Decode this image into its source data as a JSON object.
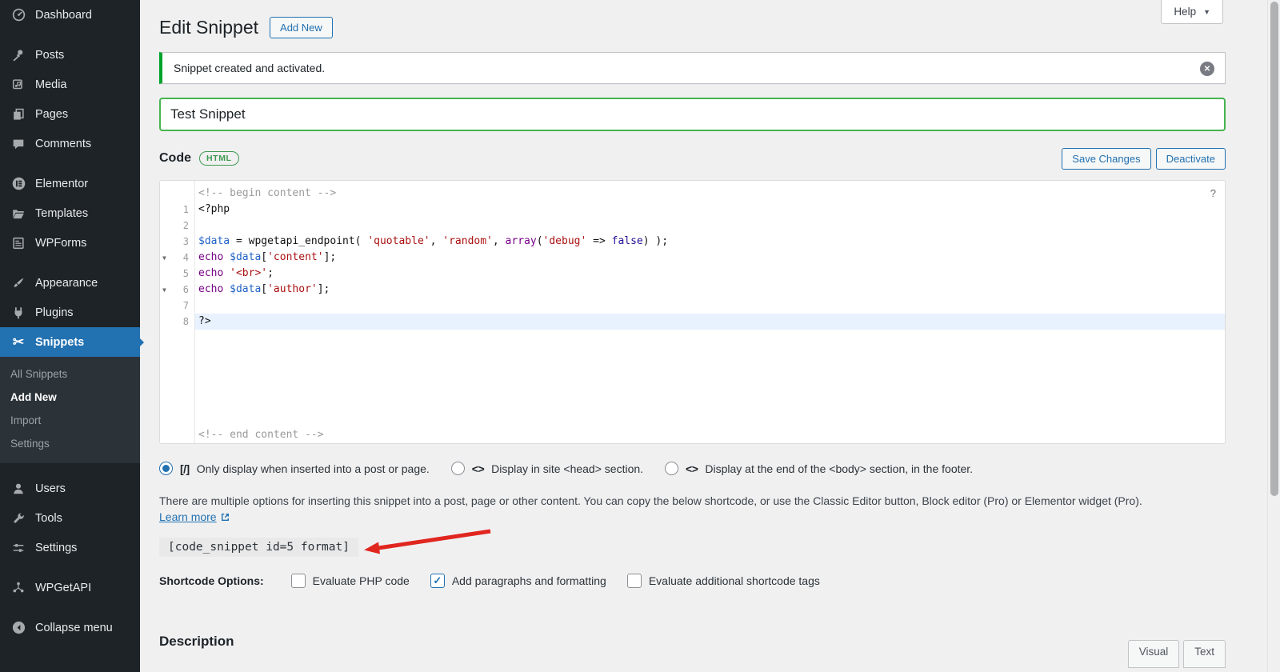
{
  "colors": {
    "accent_blue": "#2271b1",
    "title_border_green": "#46b450",
    "notice_green": "#00a32a",
    "badge_green": "#3d9a50",
    "arrow_red": "#e0261f",
    "active_line_blue": "#e8f2ff"
  },
  "sidebar": {
    "items": [
      {
        "label": "Dashboard",
        "icon": "dashboard-icon",
        "group_start": false
      },
      {
        "label": "Posts",
        "icon": "pin-icon",
        "group_start": true
      },
      {
        "label": "Media",
        "icon": "media-icon"
      },
      {
        "label": "Pages",
        "icon": "pages-icon"
      },
      {
        "label": "Comments",
        "icon": "comments-icon"
      },
      {
        "label": "Elementor",
        "icon": "elementor-icon",
        "group_start": true
      },
      {
        "label": "Templates",
        "icon": "templates-icon"
      },
      {
        "label": "WPForms",
        "icon": "wpforms-icon"
      },
      {
        "label": "Appearance",
        "icon": "appearance-icon",
        "group_start": true
      },
      {
        "label": "Plugins",
        "icon": "plugins-icon"
      },
      {
        "label": "Snippets",
        "icon": "scissors-icon",
        "active": true,
        "submenu": [
          {
            "label": "All Snippets"
          },
          {
            "label": "Add New",
            "current": true
          },
          {
            "label": "Import"
          },
          {
            "label": "Settings"
          }
        ]
      },
      {
        "label": "Users",
        "icon": "users-icon",
        "group_start": true
      },
      {
        "label": "Tools",
        "icon": "tools-icon"
      },
      {
        "label": "Settings",
        "icon": "settings-icon"
      },
      {
        "label": "WPGetAPI",
        "icon": "wpgetapi-icon",
        "group_start": true
      },
      {
        "label": "Collapse menu",
        "icon": "collapse-icon",
        "group_start": true
      }
    ]
  },
  "header": {
    "title": "Edit Snippet",
    "add_new_label": "Add New",
    "help_label": "Help"
  },
  "notice": {
    "message": "Snippet created and activated."
  },
  "snippet": {
    "title_value": "Test Snippet"
  },
  "code_section": {
    "heading": "Code",
    "badge": "HTML",
    "save_label": "Save Changes",
    "deactivate_label": "Deactivate",
    "help_glyph": "?"
  },
  "editor": {
    "lines": [
      {
        "num": "",
        "tokens": [
          {
            "t": "<!-- begin content -->",
            "c": "comment"
          }
        ]
      },
      {
        "num": "1",
        "tokens": [
          {
            "t": "<?php",
            "c": "meta"
          }
        ]
      },
      {
        "num": "2",
        "tokens": []
      },
      {
        "num": "3",
        "tokens": [
          {
            "t": "$data",
            "c": "variable"
          },
          {
            "t": " = wpgetapi_endpoint( ",
            "c": "plain"
          },
          {
            "t": "'quotable'",
            "c": "string"
          },
          {
            "t": ", ",
            "c": "plain"
          },
          {
            "t": "'random'",
            "c": "string"
          },
          {
            "t": ", ",
            "c": "plain"
          },
          {
            "t": "array",
            "c": "keyword"
          },
          {
            "t": "(",
            "c": "plain"
          },
          {
            "t": "'debug'",
            "c": "string"
          },
          {
            "t": " => ",
            "c": "plain"
          },
          {
            "t": "false",
            "c": "atom"
          },
          {
            "t": ") );",
            "c": "plain"
          }
        ]
      },
      {
        "num": "4",
        "fold": true,
        "tokens": [
          {
            "t": "echo ",
            "c": "keyword"
          },
          {
            "t": "$data",
            "c": "variable"
          },
          {
            "t": "[",
            "c": "plain"
          },
          {
            "t": "'content'",
            "c": "string"
          },
          {
            "t": "];",
            "c": "plain"
          }
        ]
      },
      {
        "num": "5",
        "tokens": [
          {
            "t": "echo ",
            "c": "keyword"
          },
          {
            "t": "'<br>'",
            "c": "string"
          },
          {
            "t": ";",
            "c": "plain"
          }
        ]
      },
      {
        "num": "6",
        "fold": true,
        "tokens": [
          {
            "t": "echo ",
            "c": "keyword"
          },
          {
            "t": "$data",
            "c": "variable"
          },
          {
            "t": "[",
            "c": "plain"
          },
          {
            "t": "'author'",
            "c": "string"
          },
          {
            "t": "];",
            "c": "plain"
          }
        ]
      },
      {
        "num": "7",
        "tokens": []
      },
      {
        "num": "8",
        "active": true,
        "tokens": [
          {
            "t": "?>",
            "c": "meta"
          }
        ]
      },
      {
        "num": "",
        "pin_bottom": true,
        "tokens": [
          {
            "t": "<!-- end content -->",
            "c": "comment"
          }
        ]
      }
    ]
  },
  "display_options": [
    {
      "glyph": "[/]",
      "label": "Only display when inserted into a post or page.",
      "selected": true
    },
    {
      "glyph": "<>",
      "label": "Display in site <head> section.",
      "selected": false
    },
    {
      "glyph": "<>",
      "label": "Display at the end of the <body> section, in the footer.",
      "selected": false
    }
  ],
  "insertion": {
    "description": "There are multiple options for inserting this snippet into a post, page or other content. You can copy the below shortcode, or use the Classic Editor button, Block editor (Pro) or Elementor widget (Pro).",
    "learn_more_label": "Learn more",
    "shortcode": "[code_snippet id=5 format]"
  },
  "shortcode_options": {
    "label": "Shortcode Options:",
    "items": [
      {
        "label": "Evaluate PHP code",
        "checked": false
      },
      {
        "label": "Add paragraphs and formatting",
        "checked": true
      },
      {
        "label": "Evaluate additional shortcode tags",
        "checked": false
      }
    ]
  },
  "description_section": {
    "heading": "Description",
    "tabs": [
      {
        "label": "Visual"
      },
      {
        "label": "Text"
      }
    ]
  }
}
